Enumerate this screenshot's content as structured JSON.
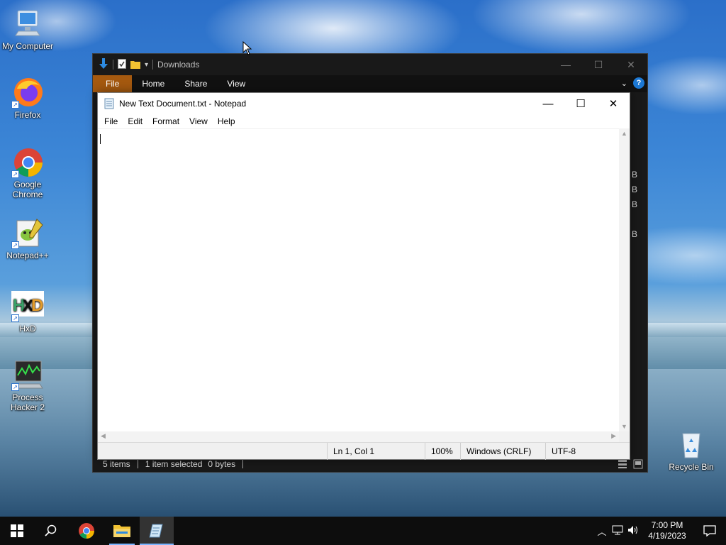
{
  "desktop": {
    "icons": [
      {
        "label": "My Computer"
      },
      {
        "label": "Firefox"
      },
      {
        "label": "Google Chrome"
      },
      {
        "label": "Notepad++"
      },
      {
        "label": "HxD"
      },
      {
        "label": "Process Hacker 2"
      },
      {
        "label": "Recycle Bin"
      }
    ]
  },
  "explorer": {
    "title": "Downloads",
    "ribbon_tabs": [
      "File",
      "Home",
      "Share",
      "View"
    ],
    "help": "?",
    "right_strip": [
      "B",
      "B",
      "B",
      "B"
    ],
    "status": {
      "items": "5 items",
      "selected": "1 item selected",
      "size": "0 bytes"
    }
  },
  "notepad": {
    "title": "New Text Document.txt - Notepad",
    "menu": [
      "File",
      "Edit",
      "Format",
      "View",
      "Help"
    ],
    "content": "",
    "status": {
      "position": "Ln 1, Col 1",
      "zoom": "100%",
      "line_ending": "Windows (CRLF)",
      "encoding": "UTF-8"
    }
  },
  "taskbar": {
    "time": "7:00 PM",
    "date": "4/19/2023"
  },
  "colors": {
    "accent": "#1c78d4",
    "file_tab": "#a5590f",
    "taskbar": "#0d0d0d"
  }
}
